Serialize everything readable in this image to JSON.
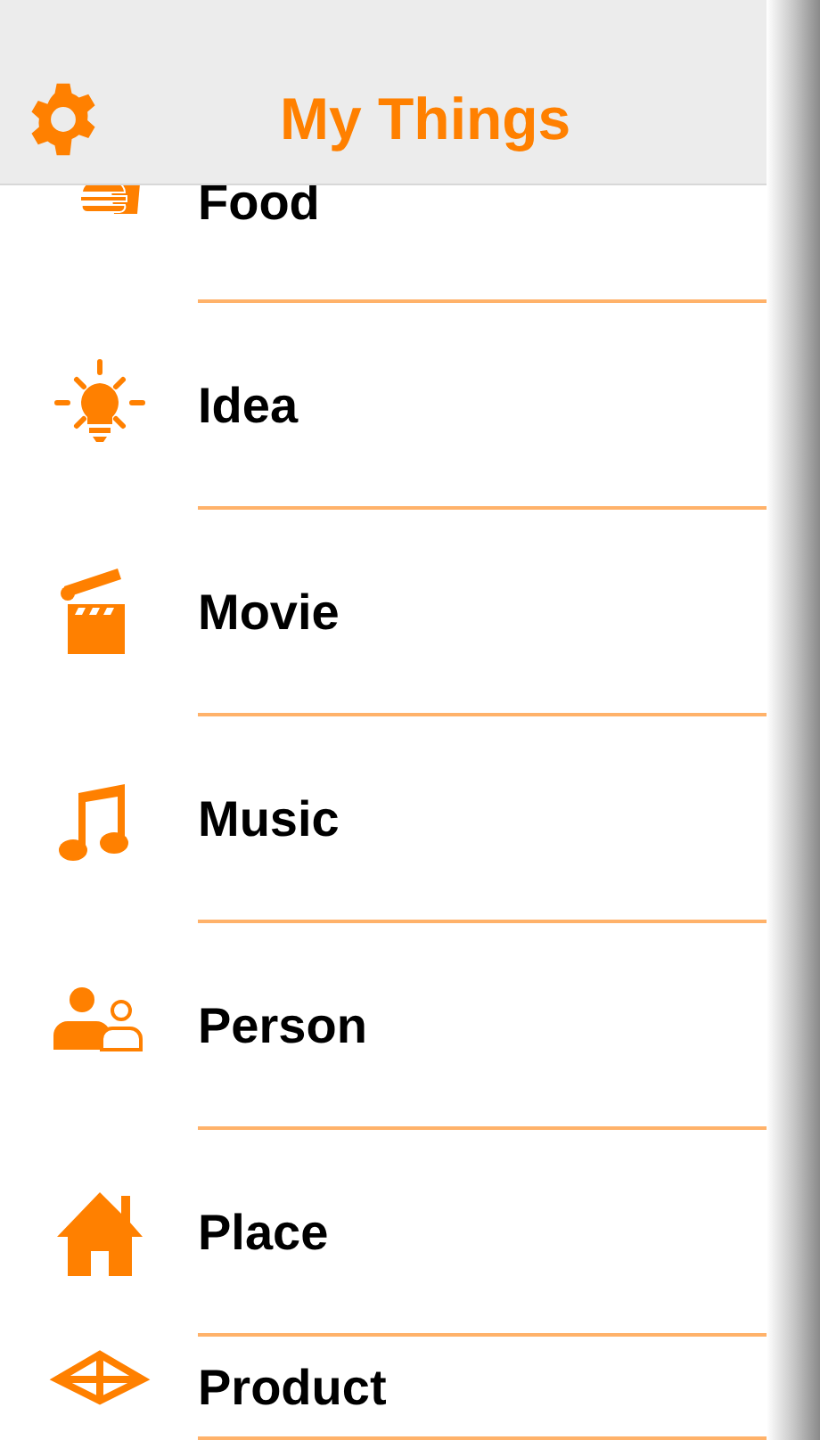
{
  "header": {
    "title": "My Things"
  },
  "items": [
    {
      "label": "Food"
    },
    {
      "label": "Idea"
    },
    {
      "label": "Movie"
    },
    {
      "label": "Music"
    },
    {
      "label": "Person"
    },
    {
      "label": "Place"
    },
    {
      "label": "Product"
    }
  ]
}
